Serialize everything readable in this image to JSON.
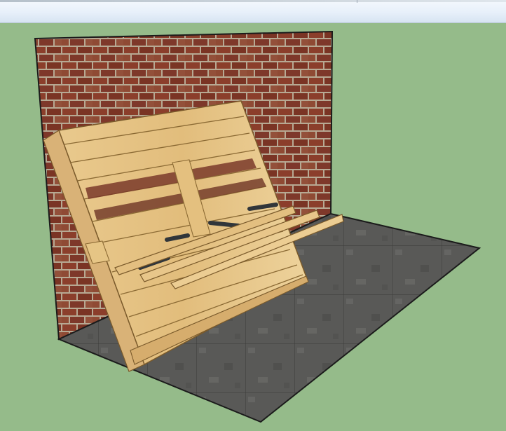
{
  "app": {
    "window_title": ""
  },
  "colors": {
    "viewport_background": "#95bb8a",
    "toolbar_top": "#f4f8fd",
    "toolbar_bottom": "#d7e4f2",
    "brick": "#8a3f2c",
    "mortar": "#b9ab94",
    "wood": "#e6c487",
    "wood_edge": "#b58c4f",
    "floor": "#5c5c5a",
    "rail": "#3e4246"
  },
  "icons": {
    "scene": "3d-model-pallet-bench"
  }
}
